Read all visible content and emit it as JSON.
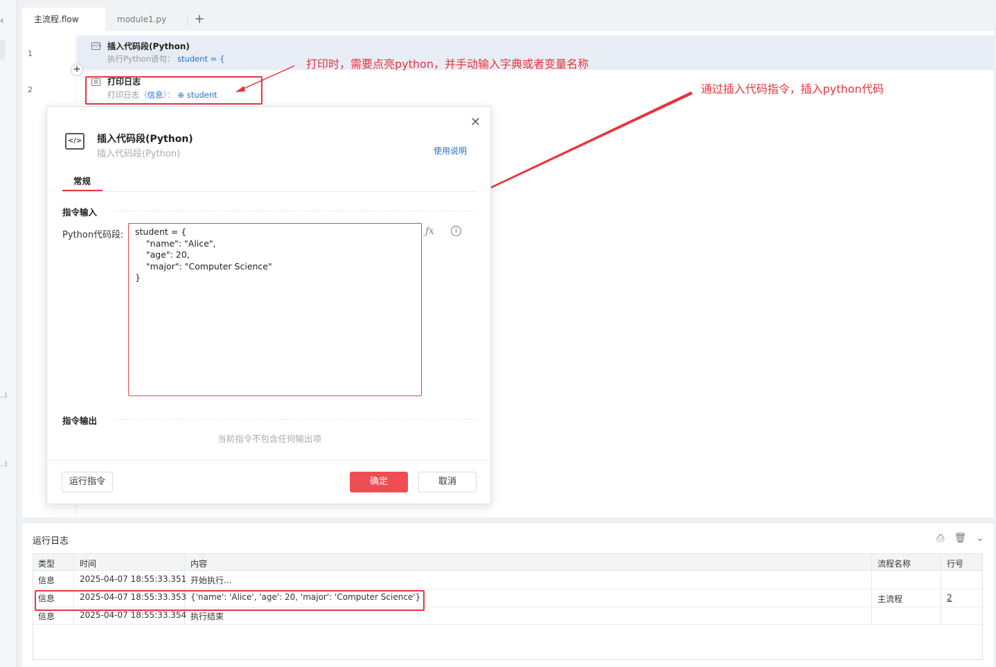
{
  "tabs": [
    {
      "label": "主流程.flow",
      "active": true
    },
    {
      "label": "module1.py",
      "active": false
    }
  ],
  "tab_add_symbol": "+",
  "flow": {
    "steps": [
      {
        "line": "1",
        "title": "插入代码段(Python)",
        "sub_label": "执行Python语句：",
        "sub_value": "student = {"
      },
      {
        "line": "2",
        "title": "打印日志",
        "sub_label": "打印日志（",
        "sub_level": "信息",
        "sub_mid": "）：",
        "sub_value": "student"
      }
    ]
  },
  "annotations": {
    "note1": "打印时，需要点亮python，并手动输入字典或者变量名称",
    "note2": "通过插入代码指令，插入python代码"
  },
  "dialog": {
    "title": "插入代码段(Python)",
    "subtitle": "插入代码段(Python)",
    "help_link": "使用说明",
    "tab": "常规",
    "input_section": "指令输入",
    "field_label": "Python代码段:",
    "code": "student = {\n    \"name\": \"Alice\",\n    \"age\": 20,\n    \"major\": \"Computer Science\"\n}",
    "output_section": "指令输出",
    "output_empty": "当前指令不包含任何输出项",
    "run_button": "运行指令",
    "ok_button": "确定",
    "cancel_button": "取消"
  },
  "log": {
    "title": "运行日志",
    "columns": [
      "类型",
      "时间",
      "内容",
      "流程名称",
      "行号"
    ],
    "rows": [
      {
        "type": "信息",
        "time": "2025-04-07 18:55:33.351",
        "content": "开始执行...",
        "flow": "",
        "line": ""
      },
      {
        "type": "信息",
        "time": "2025-04-07 18:55:33.353",
        "content": "{'name': 'Alice', 'age': 20, 'major': 'Computer Science'}",
        "flow": "主流程",
        "line": "2"
      },
      {
        "type": "信息",
        "time": "2025-04-07 18:55:33.354",
        "content": "执行结束",
        "flow": "",
        "line": ""
      }
    ]
  },
  "colors": {
    "accent_red": "#e8343d",
    "link_blue": "#1f6fd6"
  }
}
